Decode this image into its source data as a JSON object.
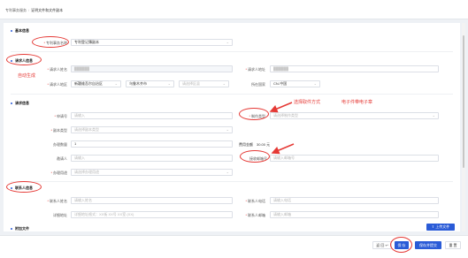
{
  "breadcrumb": {
    "parent": "专利事务服务",
    "current": "证明文件和文件副本"
  },
  "sections": {
    "basic": "基本信息",
    "requester": "请求人信息",
    "request": "请求信息",
    "contact": "联系人信息",
    "attachments": "附加文件"
  },
  "basic": {
    "service_label": "专利事务名称",
    "service_value": "专利登记簿副本"
  },
  "requester": {
    "name_label": "请求人姓名",
    "name_value": "██████",
    "address_label": "请求人地址",
    "address_value": "██████",
    "region_label": "请求人地区",
    "province": "新疆维吾尔自治区",
    "city": "乌鲁木齐市",
    "district_placeholder": "请选择区县",
    "country_label": "所在国家",
    "country_value": "CN-中国"
  },
  "request": {
    "apply_no_label": "申请号",
    "apply_no_placeholder": "请输入",
    "make_type_label": "制作类型",
    "make_type_placeholder": "请选择制作类型",
    "copy_type_label": "副本类型",
    "copy_type_placeholder": "请选择副本类型",
    "count_label": "办理数量",
    "count_value": "1",
    "fee_label": "费用金额",
    "fee_value": "30.00 元",
    "agent_label": "邀请人",
    "agent_placeholder": "请输入",
    "email_label": "接收邮箱号",
    "email_placeholder": "请输入邮箱号",
    "purpose_label": "办理用途",
    "purpose_placeholder": "请选择办理用途"
  },
  "contact": {
    "name_label": "联系人姓名",
    "name_placeholder": "请输入姓名",
    "phone_label": "联系人电话",
    "phone_placeholder": "请输入电话",
    "address_label": "详细地址",
    "address_placeholder": "详细地址格式：XX街 XX号 XX室 (XX)",
    "mail_label": "联系人邮箱",
    "mail_placeholder": "请输入邮箱"
  },
  "upload_label": "上传文件",
  "footer": {
    "back": "返 回",
    "save": "保 存",
    "save_submit": "保存并提交",
    "reset": "重 置"
  },
  "annotations": {
    "auto_generate": "自动生成",
    "choose_method": "选择取件方式",
    "electronic": "电子件带电子章"
  },
  "colors": {
    "primary": "#2a5bd7",
    "annotation": "#e53935"
  }
}
